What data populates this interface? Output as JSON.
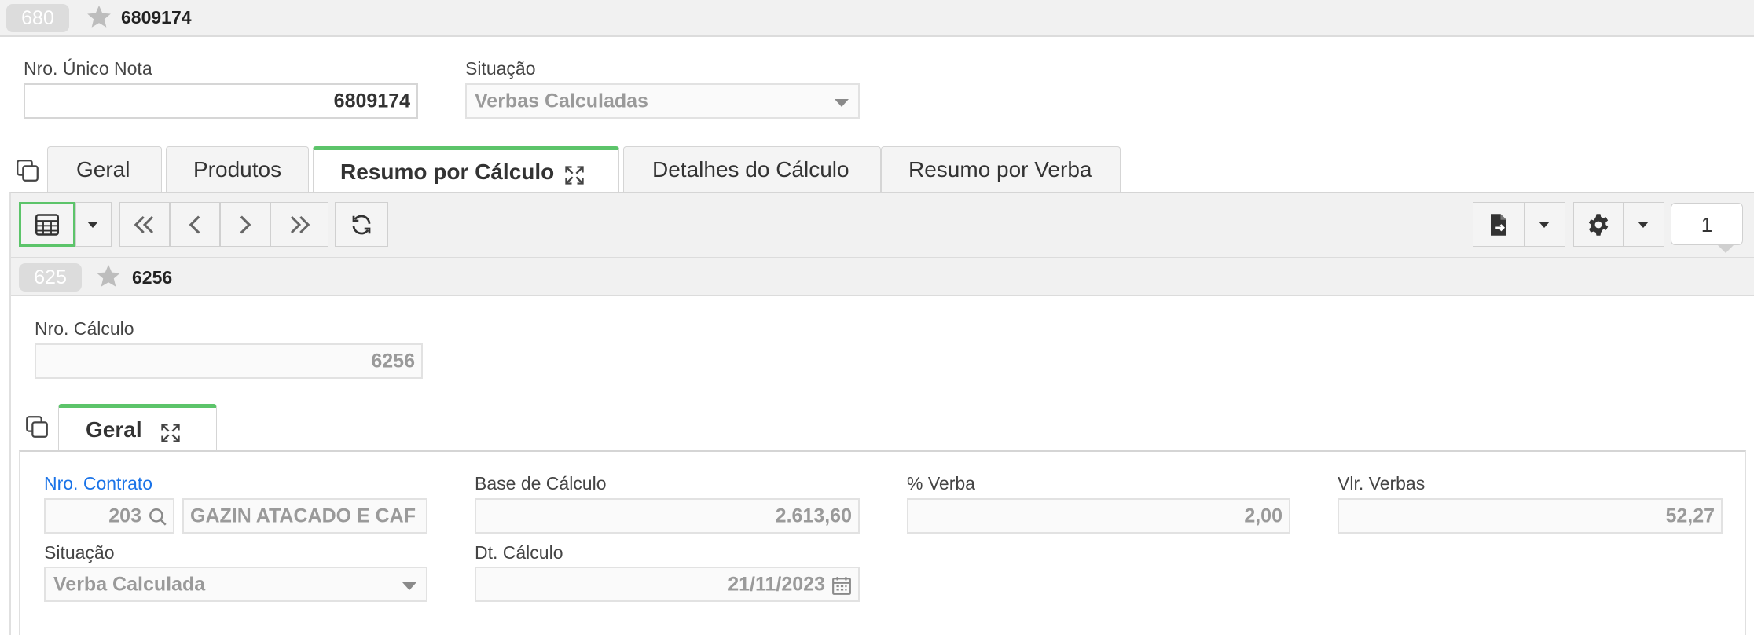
{
  "header": {
    "badge": "680",
    "record_id": "6809174"
  },
  "form": {
    "nro_unico_label": "Nro. Único Nota",
    "nro_unico_value": "6809174",
    "situacao_label": "Situação",
    "situacao_value": "Verbas Calculadas"
  },
  "tabs": [
    {
      "label": "Geral"
    },
    {
      "label": "Produtos"
    },
    {
      "label": "Resumo por Cálculo"
    },
    {
      "label": "Detalhes do Cálculo"
    },
    {
      "label": "Resumo por Verba"
    }
  ],
  "toolbar": {
    "page_number": "1"
  },
  "subheader": {
    "badge": "625",
    "record_id": "6256"
  },
  "calc": {
    "nro_calculo_label": "Nro. Cálculo",
    "nro_calculo_value": "6256"
  },
  "subtab": {
    "label": "Geral"
  },
  "detail": {
    "nro_contrato_label": "Nro. Contrato",
    "nro_contrato_value": "203",
    "contrato_nome": "GAZIN ATACADO E CAF",
    "base_calculo_label": "Base de Cálculo",
    "base_calculo_value": "2.613,60",
    "verba_label": "% Verba",
    "verba_value": "2,00",
    "vlr_verbas_label": "Vlr. Verbas",
    "vlr_verbas_value": "52,27",
    "situacao_label": "Situação",
    "situacao_value": "Verba Calculada",
    "dt_calculo_label": "Dt. Cálculo",
    "dt_calculo_value": "21/11/2023"
  },
  "colors": {
    "accent_green": "#5cc46a",
    "link_blue": "#1a73e8"
  }
}
